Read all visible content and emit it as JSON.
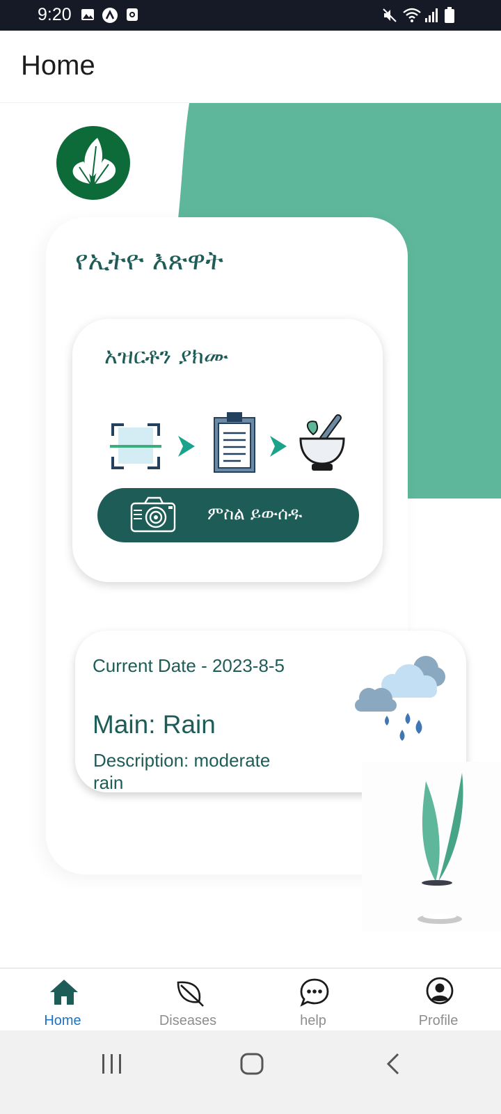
{
  "status_bar": {
    "time": "9:20",
    "left_icons": [
      "image-icon",
      "app-notification-icon",
      "screen-record-icon"
    ],
    "right_icons": [
      "mute-icon",
      "wifi-icon",
      "signal-icon",
      "battery-icon"
    ]
  },
  "header": {
    "title": "Home"
  },
  "app": {
    "name": "የኢትዮ እጽዋት",
    "logo_icon": "leaf-logo-icon"
  },
  "scan_card": {
    "title": "አዝርቶን ያክሙ",
    "steps": [
      "scan-icon",
      "chevron-right-icon",
      "clipboard-icon",
      "chevron-right-icon",
      "mortar-pestle-icon"
    ],
    "button_label": "ምስል ይውሰዱ",
    "button_icon": "camera-icon"
  },
  "weather": {
    "date": "Current Date - 2023-8-5",
    "main": "Main: Rain",
    "description": "Description: moderate rain",
    "icon": "rain-cloud-icon"
  },
  "bottom_nav": {
    "items": [
      {
        "label": "Home",
        "icon": "home-icon",
        "active": true
      },
      {
        "label": "Diseases",
        "icon": "leaf-icon",
        "active": false
      },
      {
        "label": "help",
        "icon": "chat-icon",
        "active": false
      },
      {
        "label": "Profile",
        "icon": "profile-icon",
        "active": false
      }
    ]
  },
  "system_nav": [
    "recents-icon",
    "home-circle-icon",
    "back-icon"
  ],
  "colors": {
    "primary": "#1e5c57",
    "accent_green": "#5eb79b",
    "logo_green": "#0d6b3a",
    "active_nav": "#1a73c8",
    "status_bar": "#151a26"
  }
}
